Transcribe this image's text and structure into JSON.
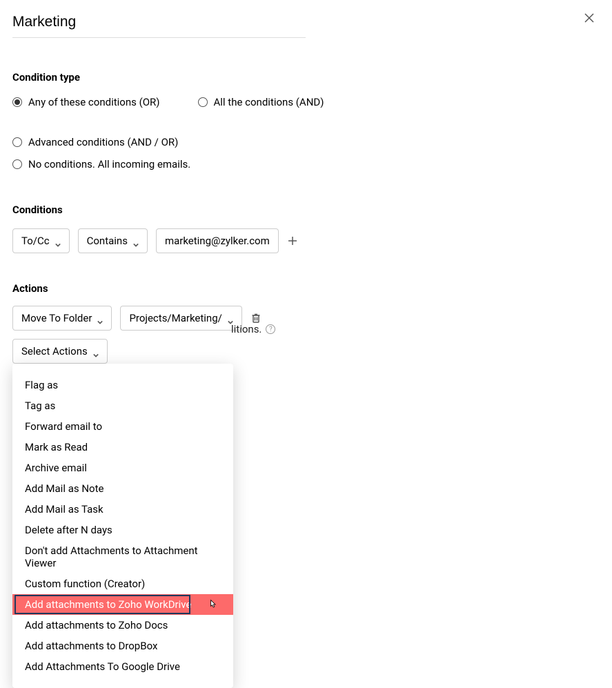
{
  "title": "Marketing",
  "sections": {
    "conditionType": {
      "heading": "Condition type",
      "options": {
        "any": "Any of these conditions (OR)",
        "all": "All the conditions (AND)",
        "advanced": "Advanced conditions (AND / OR)",
        "none": "No conditions. All incoming emails."
      },
      "selected": "any"
    },
    "conditions": {
      "heading": "Conditions",
      "row": {
        "field": "To/Cc",
        "operator": "Contains",
        "value": "marketing@zylker.com"
      }
    },
    "actions": {
      "heading": "Actions",
      "row1": {
        "action": "Move To Folder",
        "target": "Projects/Marketing/"
      },
      "selectActionsLabel": "Select Actions",
      "menu": [
        {
          "label": "Flag as"
        },
        {
          "label": "Tag as"
        },
        {
          "label": "Forward email to"
        },
        {
          "label": "Mark as Read"
        },
        {
          "label": "Archive email"
        },
        {
          "label": "Add Mail as Note"
        },
        {
          "label": "Add Mail as Task"
        },
        {
          "label": "Delete after N days"
        },
        {
          "label": "Don't add Attachments to Attachment Viewer"
        },
        {
          "label": "Custom function (Creator)"
        },
        {
          "label": "Add attachments to Zoho WorkDrive",
          "highlighted": true
        },
        {
          "label": "Add attachments to Zoho Docs"
        },
        {
          "label": "Add attachments to DropBox"
        },
        {
          "label": "Add Attachments To Google Drive"
        }
      ]
    }
  },
  "partialText": {
    "fragment": "litions.",
    "help": "?"
  }
}
